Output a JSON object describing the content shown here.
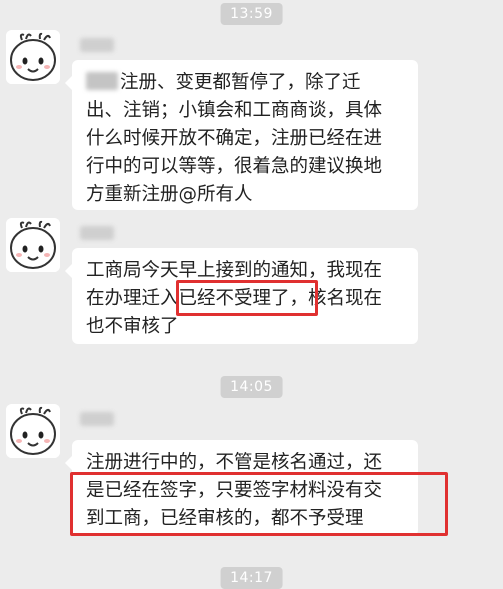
{
  "timestamps": [
    "13:59",
    "14:05",
    "14:17"
  ],
  "messages": [
    {
      "sender": "",
      "lines": [
        "注册、变更都暂停了，除了迁",
        "出、注销；小镇会和工商商谈，具体",
        "什么时候开放不确定，注册已经在进",
        "行中的可以等等，很着急的建议换地",
        "方重新注册@所有人"
      ]
    },
    {
      "sender": "",
      "lines": [
        "工商局今天早上接到的通知，我现在",
        "在办理迁入已经不受理了，核名现在",
        "也不审核了"
      ],
      "highlight": "已经不受理了，"
    },
    {
      "sender": "",
      "lines": [
        "注册进行中的，不管是核名通过，还",
        "是已经在签字，只要签字材料没有交",
        "到工商，已经审核的，都不予受理"
      ],
      "highlight": "是已经在签字，只要签字材料没有交 到工商，已经审核的，都不予受理"
    }
  ],
  "colors": {
    "background": "#ececec",
    "bubble": "#ffffff",
    "highlight_box": "#e03030",
    "time_badge": "#d0d0d0"
  },
  "icons": [
    "sticker-avatar-icon"
  ]
}
